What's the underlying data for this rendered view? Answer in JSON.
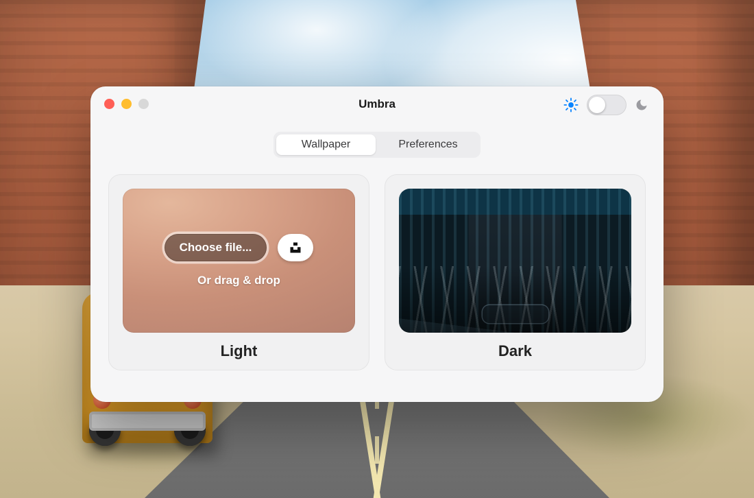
{
  "window": {
    "title": "Umbra",
    "tabs": [
      {
        "label": "Wallpaper",
        "active": true
      },
      {
        "label": "Preferences",
        "active": false
      }
    ],
    "theme_toggle": {
      "state": "light"
    }
  },
  "cards": {
    "light": {
      "label": "Light",
      "choose_label": "Choose file...",
      "drop_hint": "Or drag & drop"
    },
    "dark": {
      "label": "Dark"
    }
  },
  "icons": {
    "sun": "sun-icon",
    "moon": "moon-icon",
    "unsplash": "unsplash-icon"
  },
  "colors": {
    "accent_blue": "#0a84ff",
    "window_bg": "#f6f6f7"
  }
}
